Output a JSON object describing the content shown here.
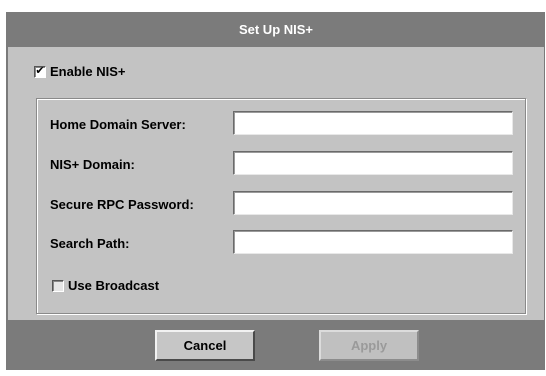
{
  "window": {
    "title": "Set Up NIS+"
  },
  "enable_nis": {
    "label": "Enable NIS+",
    "checked": true,
    "check_glyph": "✔"
  },
  "fields": [
    {
      "label": "Home Domain Server:",
      "value": ""
    },
    {
      "label": "NIS+ Domain:",
      "value": ""
    },
    {
      "label": "Secure RPC Password:",
      "value": ""
    },
    {
      "label": "Search Path:",
      "value": ""
    }
  ],
  "use_broadcast": {
    "label": "Use Broadcast",
    "checked": false
  },
  "buttons": {
    "cancel_label": "Cancel",
    "apply_label": "Apply",
    "apply_enabled": false
  },
  "colors": {
    "dialog_bg": "#c3c3c3",
    "title_bar_bg": "#7b7b7b",
    "disabled_text": "#9a9a9a"
  }
}
